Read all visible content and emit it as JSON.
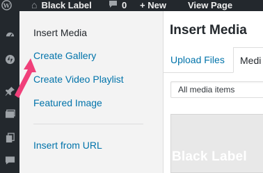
{
  "admin_bar": {
    "site_name": "Black Label",
    "comments_count": "0",
    "new_label": "+ New",
    "view_page_label": "View Page",
    "icons": [
      "wordpress-icon",
      "home-icon",
      "comment-icon"
    ]
  },
  "admin_menu": {
    "icons": [
      "dashboard-icon",
      "jetpack-icon",
      "pin-icon",
      "media-icon",
      "pages-icon",
      "comments-icon"
    ]
  },
  "modal_menu": {
    "title": "Insert Media",
    "items": [
      {
        "label": "Create Gallery"
      },
      {
        "label": "Create Video Playlist"
      },
      {
        "label": "Featured Image"
      },
      {
        "label": "Insert from URL"
      }
    ]
  },
  "modal_frame": {
    "title": "Insert Media",
    "tabs": [
      {
        "label": "Upload Files"
      },
      {
        "label": "Medi"
      }
    ],
    "filter": {
      "value": "All media items"
    },
    "thumbnail": {
      "text": "Black Label"
    }
  },
  "colors": {
    "admin_bg": "#23282d",
    "link": "#0073aa",
    "menu_bg": "#f3f3f3",
    "annotation_arrow": "#f0407a"
  }
}
